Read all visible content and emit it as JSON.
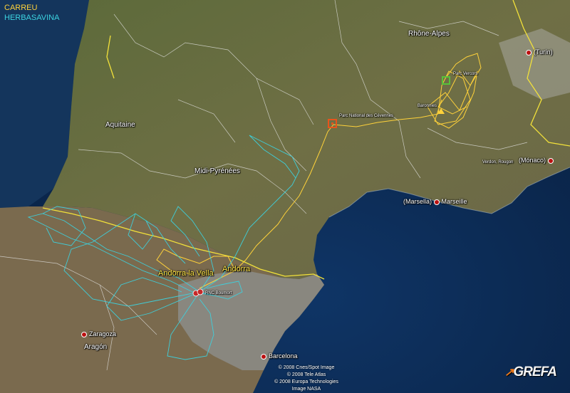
{
  "legend": [
    {
      "label": "CARREU",
      "color": "#ffd23a"
    },
    {
      "label": "HERBASAVINA",
      "color": "#3cd3e0"
    }
  ],
  "regions": {
    "aquitaine": "Aquitaine",
    "midi_pyrenees": "Midi-Pyrénées",
    "rhone_alpes": "Rhône-Alpes",
    "aragon": "Aragón"
  },
  "cities": {
    "turin": "(Turín)",
    "monaco": "(Mónaco)",
    "marsella": "(Marsella)",
    "marseille": "Marseille",
    "zaragoza": "Zaragoza",
    "barcelona": "Barcelona"
  },
  "yellow_labels": {
    "andorra_la_vella": "Andorra la Vella",
    "andorra": "Andorra"
  },
  "places": {
    "parc_cevennes": "Parc National des Cévennes",
    "parc_vercors": "Parc Vercors",
    "baronnies": "Baronnies",
    "verdon": "Verdon, Rougon",
    "rnc_boumort": "RNC Boumort"
  },
  "credits": [
    "© 2008 Cnes/Spot Image",
    "© 2008 Tele Atlas",
    "© 2008 Europa Technologies",
    "Image NASA"
  ],
  "logo": "GREFA"
}
